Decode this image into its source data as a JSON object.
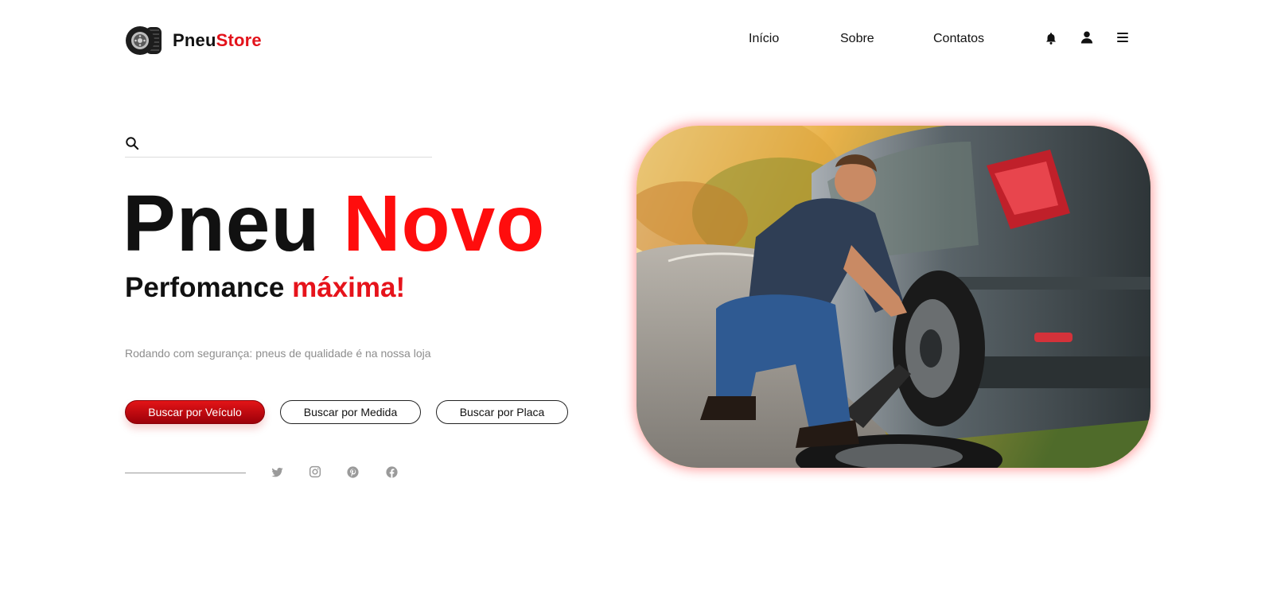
{
  "brand": {
    "name_part1": "Pneu",
    "name_part2": "Store",
    "accent_color": "#e3131b"
  },
  "nav": {
    "items": [
      "Início",
      "Sobre",
      "Contatos"
    ]
  },
  "header_icons": [
    "bell-icon",
    "user-icon",
    "menu-icon"
  ],
  "search": {
    "placeholder": "",
    "value": ""
  },
  "hero": {
    "title_part1": "Pneu",
    "title_part2": "Novo",
    "subtitle_part1": "Perfomance",
    "subtitle_part2": "máxima!",
    "tagline": "Rodando com segurança: pneus de qualidade é na nossa loja"
  },
  "buttons": {
    "by_vehicle": "Buscar por Veículo",
    "by_size": "Buscar por Medida",
    "by_plate": "Buscar por Placa"
  },
  "social": [
    "twitter-icon",
    "instagram-icon",
    "pinterest-icon",
    "facebook-icon"
  ],
  "colors": {
    "accent": "#ff0d0d",
    "primary_button": "#c8080f",
    "muted_text": "#8d8d8d"
  }
}
